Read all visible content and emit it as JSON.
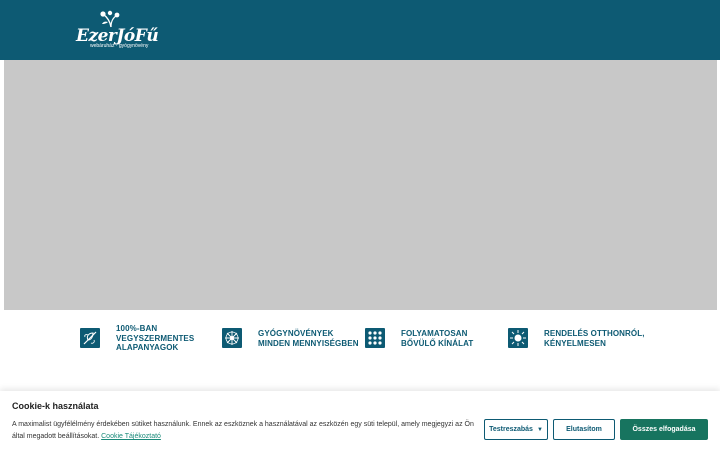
{
  "header": {
    "logo": {
      "wordmark": "EzerJóFű",
      "tagline": "webáruház · gyógynövény"
    }
  },
  "colors": {
    "brand": "#0d5a73",
    "accept": "#17745f",
    "link": "#1a8a7a",
    "hero_placeholder": "#c8c8c8"
  },
  "features": [
    {
      "icon": "plant-leaf-icon",
      "lines": [
        "100%-BAN",
        "VEGYSZERMENTES",
        "ALAPANYAGOK"
      ]
    },
    {
      "icon": "herb-flower-icon",
      "lines": [
        "GYÓGYNÖVÉNYEK",
        "MINDEN MENNYISÉGBEN"
      ]
    },
    {
      "icon": "seeds-grid-icon",
      "lines": [
        "FOLYAMATOSAN",
        "BŐVÜLŐ KÍNÁLAT"
      ]
    },
    {
      "icon": "sun-burst-icon",
      "lines": [
        "RENDELÉS OTTHONRÓL,",
        "KÉNYELMESEN"
      ]
    }
  ],
  "cookie": {
    "title": "Cookie-k használata",
    "text": "A maximalist ügyfélélmény érdekében sütiket használunk. Ennek az eszköznek a használatával az eszközén egy süti települ, amely megjegyzi az Ön által megadott beállításokat.",
    "link": "Cookie Tájékoztató",
    "buttons": {
      "settings": "Testreszabás",
      "reject": "Elutasítom",
      "accept": "Összes elfogadása"
    }
  }
}
